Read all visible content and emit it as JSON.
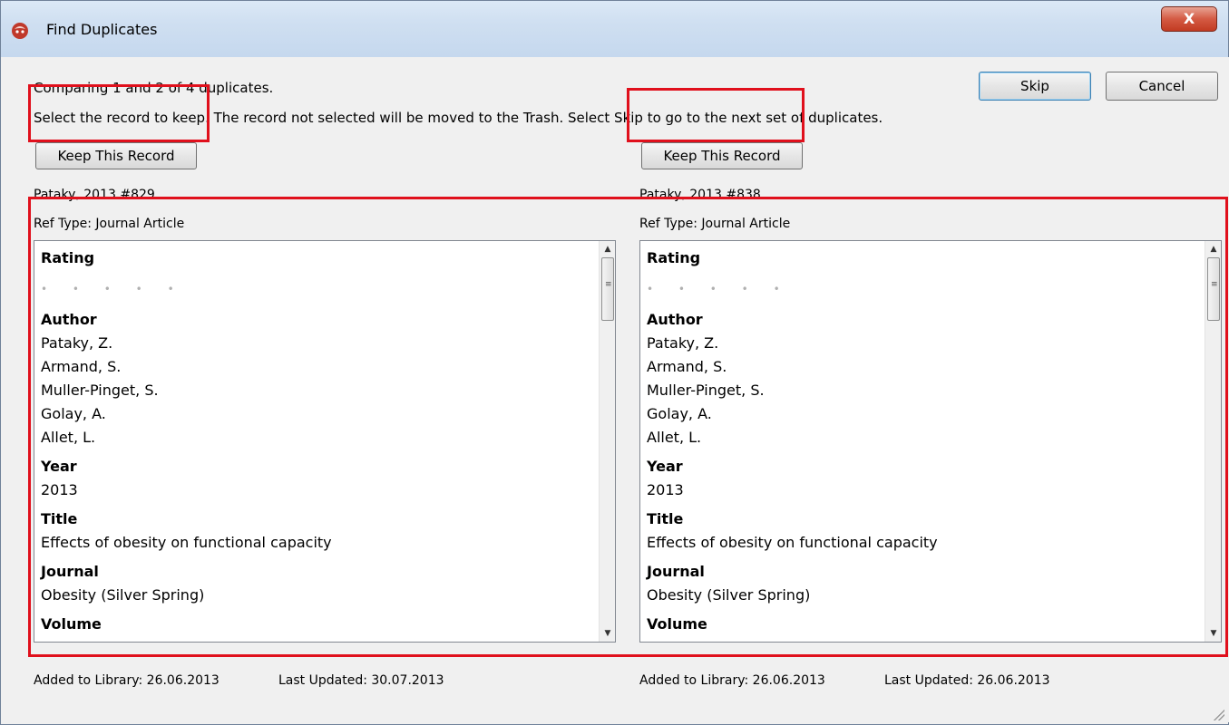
{
  "window": {
    "title": "Find Duplicates",
    "close_label": "X"
  },
  "header": {
    "comparing_text": "Comparing 1 and 2 of 4 duplicates.",
    "instruction_text": "Select the record to keep. The record not selected will be moved to the Trash. Select Skip to go to the next set of duplicates.",
    "skip_label": "Skip",
    "cancel_label": "Cancel"
  },
  "left": {
    "keep_label": "Keep This Record",
    "record_id": "Pataky, 2013 #829",
    "ref_type": "Ref Type: Journal Article",
    "rating_title": "Rating",
    "rating_dots": "• • • • •",
    "author_title": "Author",
    "authors": [
      "Pataky, Z.",
      "Armand, S.",
      "Muller-Pinget, S.",
      "Golay, A.",
      "Allet, L."
    ],
    "year_title": "Year",
    "year": "2013",
    "title_title": "Title",
    "title": "Effects of obesity on functional capacity",
    "journal_title": "Journal",
    "journal": "Obesity (Silver Spring)",
    "volume_title": "Volume",
    "added": "Added to Library: 26.06.2013",
    "updated": "Last Updated: 30.07.2013"
  },
  "right": {
    "keep_label": "Keep This Record",
    "record_id": "Pataky, 2013 #838",
    "ref_type": "Ref Type: Journal Article",
    "rating_title": "Rating",
    "rating_dots": "• • • • •",
    "author_title": "Author",
    "authors": [
      "Pataky, Z.",
      "Armand, S.",
      "Muller-Pinget, S.",
      "Golay, A.",
      "Allet, L."
    ],
    "year_title": "Year",
    "year": "2013",
    "title_title": "Title",
    "title": "Effects of obesity on functional capacity",
    "journal_title": "Journal",
    "journal": "Obesity (Silver Spring)",
    "volume_title": "Volume",
    "added": "Added to Library: 26.06.2013",
    "updated": "Last Updated: 26.06.2013"
  },
  "colors": {
    "annotation_red": "#e0101c",
    "titlebar": "#cfdff1",
    "close_button": "#c23b22"
  }
}
